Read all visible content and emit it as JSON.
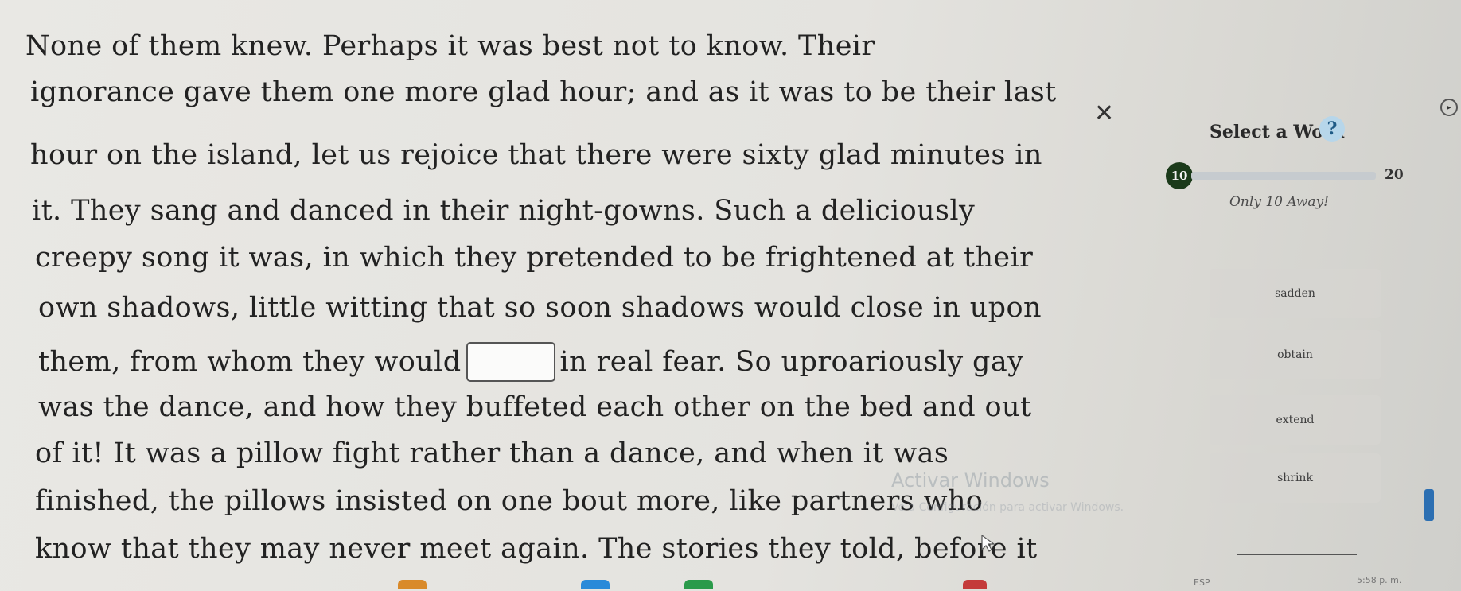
{
  "passage": {
    "lines": [
      "None of them knew. Perhaps it was best not to know. Their",
      "ignorance gave them one more glad hour; and as it was to be their last",
      "hour on the island, let us rejoice that there were sixty glad minutes in",
      "it. They sang and danced in their night-gowns. Such a deliciously",
      "creepy song it was, in which they pretended to be frightened at their",
      "own shadows, little witting that so soon shadows would close in upon",
      "was the dance, and how they buffeted each other on the bed and out",
      "of it! It was a pillow fight rather than a dance, and when it was",
      "finished, the pillows insisted on one bout more, like partners who",
      "know that they may never meet again. The stories they told, before it"
    ],
    "blank_line": {
      "before": "them, from whom they would",
      "after": "in real fear. So uproariously gay"
    }
  },
  "panel": {
    "title": "Select a Word",
    "progress_current": "10",
    "progress_goal": "20",
    "progress_fraction": 0.0,
    "progress_message": "Only 10 Away!",
    "options": [
      "sadden",
      "obtain",
      "extend",
      "shrink"
    ]
  },
  "watermark": {
    "title": "Activar Windows",
    "subtitle": "Ve a Configuración para activar Windows."
  },
  "taskbar": {
    "language": "ESP",
    "time": "5:58 p. m."
  },
  "colors": {
    "progress_badge": "#1b3a1a",
    "help_icon_bg": "#b7d6ea",
    "scroll_accent": "#2c6fb2"
  },
  "icons": {
    "close": "close-icon",
    "help": "help-icon",
    "circle": "circle-icon",
    "cursor": "mouse-cursor-icon"
  }
}
